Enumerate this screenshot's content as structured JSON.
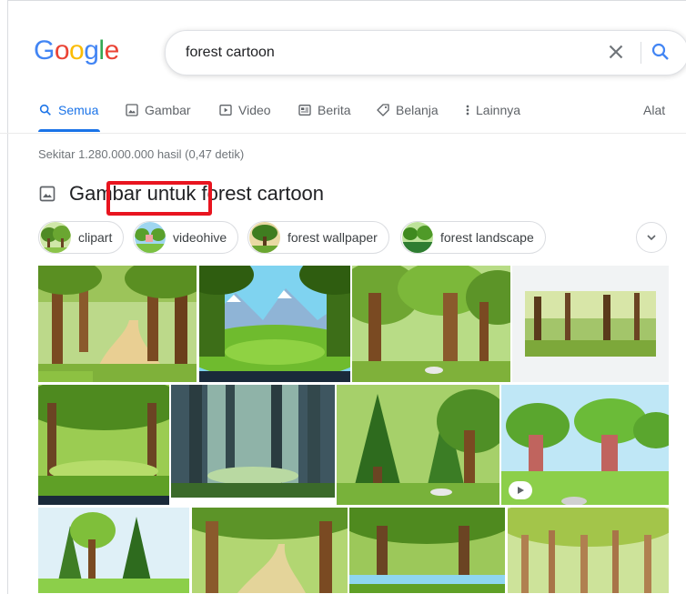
{
  "logo": [
    "G",
    "o",
    "o",
    "g",
    "l",
    "e"
  ],
  "logo_colors": [
    "#4285f4",
    "#ea4335",
    "#fbbc05",
    "#4285f4",
    "#34a853",
    "#ea4335"
  ],
  "search": {
    "query": "forest cartoon",
    "clear_icon": "close-icon",
    "search_icon": "search-icon"
  },
  "tabs": [
    {
      "label": "Semua",
      "icon": "search-icon",
      "active": true
    },
    {
      "label": "Gambar",
      "icon": "image-icon"
    },
    {
      "label": "Video",
      "icon": "video-icon"
    },
    {
      "label": "Berita",
      "icon": "news-icon"
    },
    {
      "label": "Belanja",
      "icon": "tag-icon"
    },
    {
      "label": "Lainnya",
      "icon": "more-vert-icon"
    }
  ],
  "tools_label": "Alat",
  "result_stats": "Sekitar 1.280.000.000 hasil (0,47 detik)",
  "images_section": {
    "title": "Gambar untuk forest cartoon",
    "icon": "image-icon"
  },
  "chips": [
    {
      "label": "clipart"
    },
    {
      "label": "videohive"
    },
    {
      "label": "forest wallpaper"
    },
    {
      "label": "forest landscape"
    }
  ],
  "colors": {
    "accent": "#1a73e8",
    "highlight": "#e8141f"
  }
}
